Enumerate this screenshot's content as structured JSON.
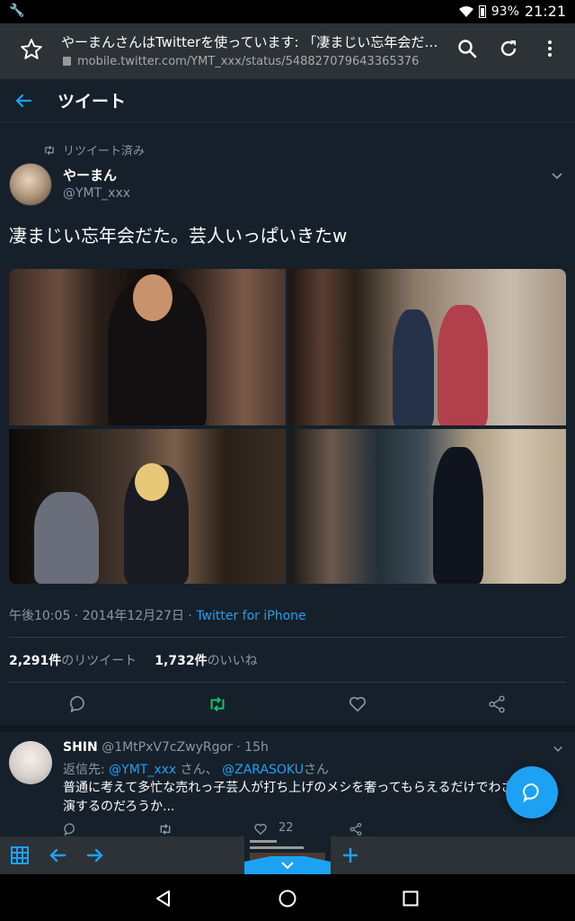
{
  "status_bar": {
    "battery": "93%",
    "time": "21:21"
  },
  "browser": {
    "page_title": "やーまんさんはTwitterを使っています: 「凄まじい忘年会だた。芸人いっぱいきたw」",
    "url": "mobile.twitter.com/YMT_xxx/status/548827079643365376"
  },
  "header": {
    "title": "ツイート"
  },
  "tweet": {
    "retweet_label": "リツイート済み",
    "name": "やーまん",
    "handle": "@YMT_xxx",
    "text": "凄まじい忘年会だた。芸人いっぱいきたw",
    "timestamp": "午後10:05 · 2014年12月27日 · ",
    "source": "Twitter for iPhone",
    "retweet_count": "2,291件",
    "retweet_label_stat": "のリツイート",
    "like_count": "1,732件",
    "like_label_stat": "のいいね"
  },
  "reply": {
    "name": "SHIN",
    "handle_time": "@1MtPxV7cZwyRgor · 15h",
    "reply_prefix": "返信先: ",
    "mention1": "@YMT_xxx",
    "mention1_suffix": " さん、 ",
    "mention2": "@ZARASOKU",
    "mention2_suffix": "さん",
    "text": "普通に考えて多忙な売れっ子芸人が打ち上げのメシを奢ってもらえるだけでわざわざ出演するのだろうか...",
    "like_count": "22"
  },
  "colors": {
    "accent": "#1da1f2",
    "retweet_green": "#17bf63",
    "background": "#15202b"
  }
}
